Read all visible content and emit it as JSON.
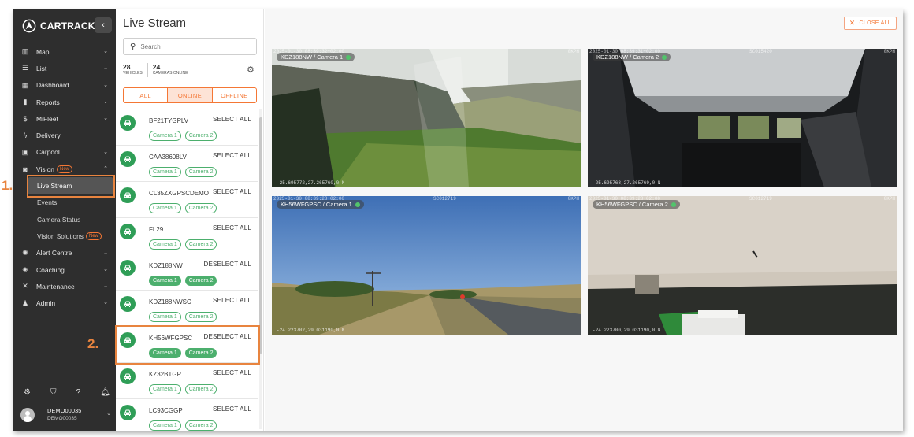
{
  "brand": {
    "name": "CARTRACK",
    "collapse_icon": "chevron-left-icon"
  },
  "nav": [
    {
      "label": "Map",
      "icon": "map-icon",
      "chevron": "down"
    },
    {
      "label": "List",
      "icon": "list-icon",
      "chevron": "down"
    },
    {
      "label": "Dashboard",
      "icon": "dashboard-icon",
      "chevron": "down"
    },
    {
      "label": "Reports",
      "icon": "bar-chart-icon",
      "chevron": "down"
    },
    {
      "label": "MiFleet",
      "icon": "dollar-icon",
      "chevron": "down"
    },
    {
      "label": "Delivery",
      "icon": "lightning-icon",
      "chevron": ""
    },
    {
      "label": "Carpool",
      "icon": "calendar-icon",
      "chevron": "down"
    },
    {
      "label": "Vision",
      "icon": "camera-icon",
      "chevron": "up",
      "badge": "New"
    }
  ],
  "vision_sub": [
    {
      "label": "Live Stream",
      "active": true
    },
    {
      "label": "Events"
    },
    {
      "label": "Camera Status"
    },
    {
      "label": "Vision Solutions",
      "badge": "New"
    }
  ],
  "nav_after": [
    {
      "label": "Alert Centre",
      "icon": "alert-gear-icon",
      "chevron": "down"
    },
    {
      "label": "Coaching",
      "icon": "coaching-icon",
      "chevron": "down"
    },
    {
      "label": "Maintenance",
      "icon": "wrench-icon",
      "chevron": "down"
    },
    {
      "label": "Admin",
      "icon": "admin-icon",
      "chevron": "down"
    }
  ],
  "user": {
    "name": "DEMO00035",
    "sub": "DEMO00035"
  },
  "panel": {
    "title": "Live Stream",
    "search_placeholder": "Search",
    "vehicles_count": "28",
    "vehicles_label": "VEHICLES",
    "cameras_count": "24",
    "cameras_label": "CAMERAS ONLINE",
    "filters": [
      "ALL",
      "ONLINE",
      "OFFLINE"
    ],
    "active_filter": "ONLINE"
  },
  "vehicles": [
    {
      "name": "BF21TYGPLV",
      "action": "SELECT ALL",
      "cams": [
        "Camera 1",
        "Camera 2"
      ],
      "active": [
        false,
        false
      ]
    },
    {
      "name": "CAA38608LV",
      "action": "SELECT ALL",
      "cams": [
        "Camera 1",
        "Camera 2"
      ],
      "active": [
        false,
        false
      ]
    },
    {
      "name": "CL35ZXGPSCDEMO",
      "action": "SELECT ALL",
      "cams": [
        "Camera 1",
        "Camera 2"
      ],
      "active": [
        false,
        false
      ]
    },
    {
      "name": "FL29",
      "action": "SELECT ALL",
      "cams": [
        "Camera 1",
        "Camera 2"
      ],
      "active": [
        false,
        false
      ]
    },
    {
      "name": "KDZ188NW",
      "action": "DESELECT ALL",
      "cams": [
        "Camera 1",
        "Camera 2"
      ],
      "active": [
        true,
        true
      ]
    },
    {
      "name": "KDZ188NWSC",
      "action": "SELECT ALL",
      "cams": [
        "Camera 1",
        "Camera 2"
      ],
      "active": [
        false,
        false
      ]
    },
    {
      "name": "KH56WFGPSC",
      "action": "DESELECT ALL",
      "cams": [
        "Camera 1",
        "Camera 2"
      ],
      "active": [
        true,
        true
      ]
    },
    {
      "name": "KZ32BTGP",
      "action": "SELECT ALL",
      "cams": [
        "Camera 1",
        "Camera 2"
      ],
      "active": [
        false,
        false
      ]
    },
    {
      "name": "LC93CGGP",
      "action": "SELECT ALL",
      "cams": [
        "Camera 1",
        "Camera 2"
      ],
      "active": [
        false,
        false
      ]
    }
  ],
  "main": {
    "close_all": "CLOSE ALL"
  },
  "videos": [
    {
      "label": "KDZ188NW / Camera 1",
      "osd_top": "2025-01-30 08:39:32+02:00",
      "osd_mid": "",
      "osd_right": "0KPH",
      "osd_bottom": "-25.695772,27.265760,0 N"
    },
    {
      "label": "KDZ188NW / Camera 2",
      "osd_top": "2025-01-30 08:39:31+02:00",
      "osd_mid": "SC015420",
      "osd_right": "0KPH",
      "osd_bottom": "-25.695768,27.265769,0 N"
    },
    {
      "label": "KH56WFGPSC / Camera 1",
      "osd_top": "2025-01-30 08:39:28+02:00",
      "osd_mid": "SC012719",
      "osd_right": "0KPH",
      "osd_bottom": "-24.223702,29.031190,0 N"
    },
    {
      "label": "KH56WFGPSC / Camera 2",
      "osd_top": "2025-01-30 08:39:28+02:00",
      "osd_mid": "SC012719",
      "osd_right": "0KPH",
      "osd_bottom": "-24.223700,29.031190,0 N"
    }
  ],
  "annotations": [
    "1.",
    "2."
  ],
  "colors": {
    "accent": "#f47735",
    "sidebar": "#2e2e2e",
    "green": "#2f9e57",
    "annotation": "#e8843f"
  }
}
